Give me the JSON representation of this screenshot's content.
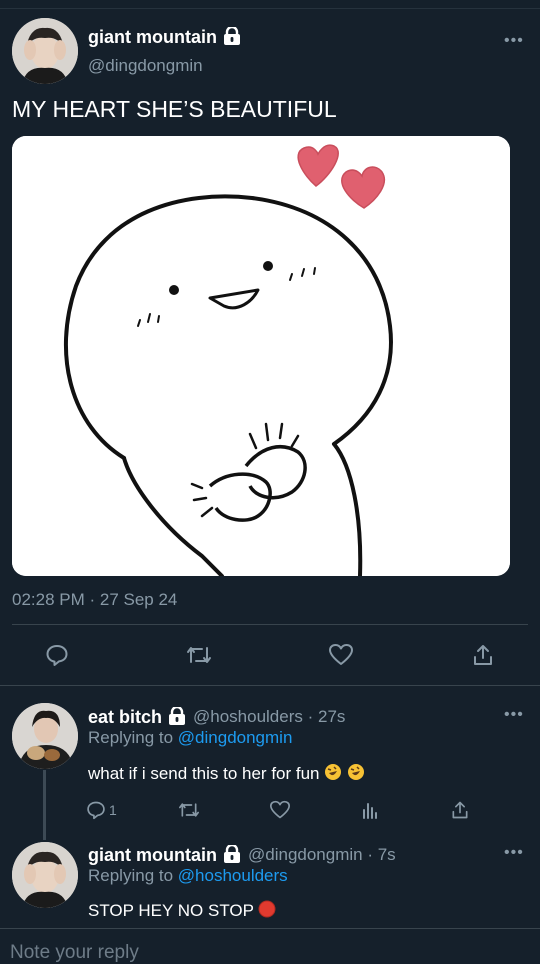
{
  "main_tweet": {
    "display_name": "giant mountain",
    "handle": "@dingdongmin",
    "text": "MY HEART SHE’S BEAUTIFUL",
    "timestamp": "02:28 PM · 27 Sep 24",
    "more": "•••"
  },
  "reply_1": {
    "display_name": "eat bitch",
    "handle": "@hoshoulders",
    "time": "· 27s",
    "replying_prefix": "Replying to",
    "replying_to": "@dingdongmin",
    "text": "what if i send this to her for fun",
    "reply_count": "1",
    "more": "•••"
  },
  "reply_2": {
    "display_name": "giant mountain",
    "handle": "@dingdongmin",
    "time": "· 7s",
    "replying_prefix": "Replying to",
    "replying_to": "@hoshoulders",
    "text": "STOP HEY NO STOP",
    "more": "•••"
  },
  "composer": {
    "placeholder": "Note your reply"
  },
  "colors": {
    "background": "#15202b",
    "secondary_text": "#8899a6",
    "link": "#1d9bf0",
    "divider": "#38444d",
    "heart_pink": "#e0606f"
  }
}
